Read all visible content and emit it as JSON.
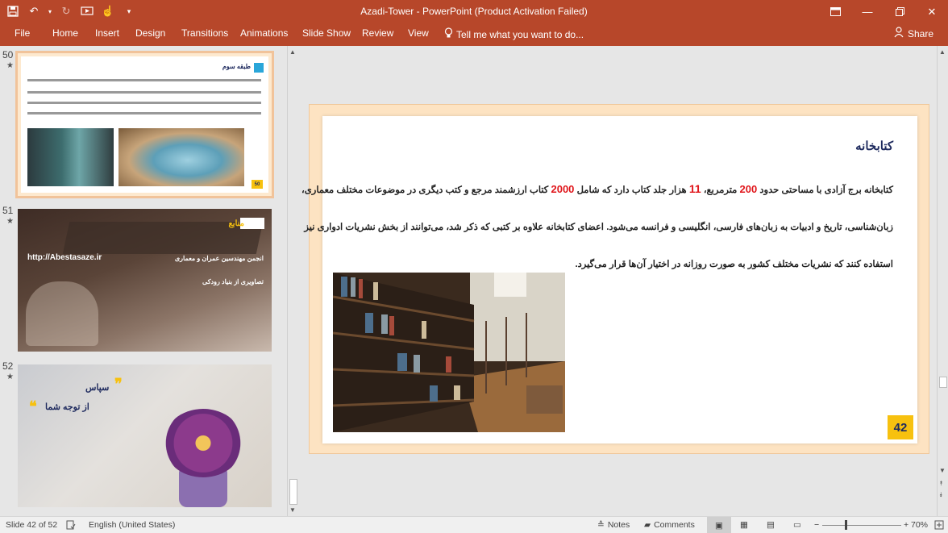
{
  "window": {
    "title": "Azadi-Tower - PowerPoint (Product Activation Failed)",
    "qat_icons": [
      "save-icon",
      "undo-icon",
      "redo-icon",
      "start-from-beginning-icon",
      "touch-mode-icon",
      "customize-qat-icon"
    ],
    "controls": [
      "ribbon-display-options-icon",
      "minimize-icon",
      "maximize-icon",
      "close-icon"
    ]
  },
  "ribbon": {
    "tabs": [
      "File",
      "Home",
      "Insert",
      "Design",
      "Transitions",
      "Animations",
      "Slide Show",
      "Review",
      "View"
    ],
    "tell_me": "Tell me what you want to do...",
    "share": "Share"
  },
  "thumbnails": [
    {
      "number": "50",
      "star": "★",
      "title": "طبقه سوم",
      "badge": "50"
    },
    {
      "number": "51",
      "star": "★",
      "title": "منابع",
      "url": "http://Abestasaze.ir",
      "line1": "انجمن مهندسین عمران و معماری",
      "line2": "تصاویری از بنیاد رودکی"
    },
    {
      "number": "52",
      "star": "★",
      "quote_mark": "❞",
      "line1": "سپاس",
      "line2": "از توجه شما"
    }
  ],
  "slide": {
    "title": "کتابخانه",
    "para1_a": "کتابخانه برج آزادی با مساحتی حدود ",
    "para1_n1": "200",
    "para1_b": " مترمربع، ",
    "para1_n2": "11",
    "para1_c": " هزار جلد کتاب دارد که شامل ",
    "para1_n3": "2000",
    "para1_d": " کتاب ارزشمند مرجع و کتب دیگری در موضوعات مختلف معماری،",
    "para2": "زبان‌شناسی، تاریخ و ادبیات به زبان‌های فارسی، انگلیسی و فرانسه می‌شود. اعضای کتابخانه علاوه بر کتبی که ذکر شد، می‌توانند از بخش نشریات ادواری نیز",
    "para3": "استفاده کنند که نشریات مختلف کشور به صورت روزانه در اختیار آن‌ها قرار می‌گیرد.",
    "page_badge": "42"
  },
  "status": {
    "slide_info": "Slide 42 of 52",
    "language": "English (United States)",
    "notes": "Notes",
    "comments": "Comments",
    "zoom": "70%"
  },
  "colors": {
    "ribbon": "#b7472a",
    "accent_yellow": "#f7c10f",
    "highlight_red": "#e0161b",
    "title_navy": "#1e2a5e"
  }
}
